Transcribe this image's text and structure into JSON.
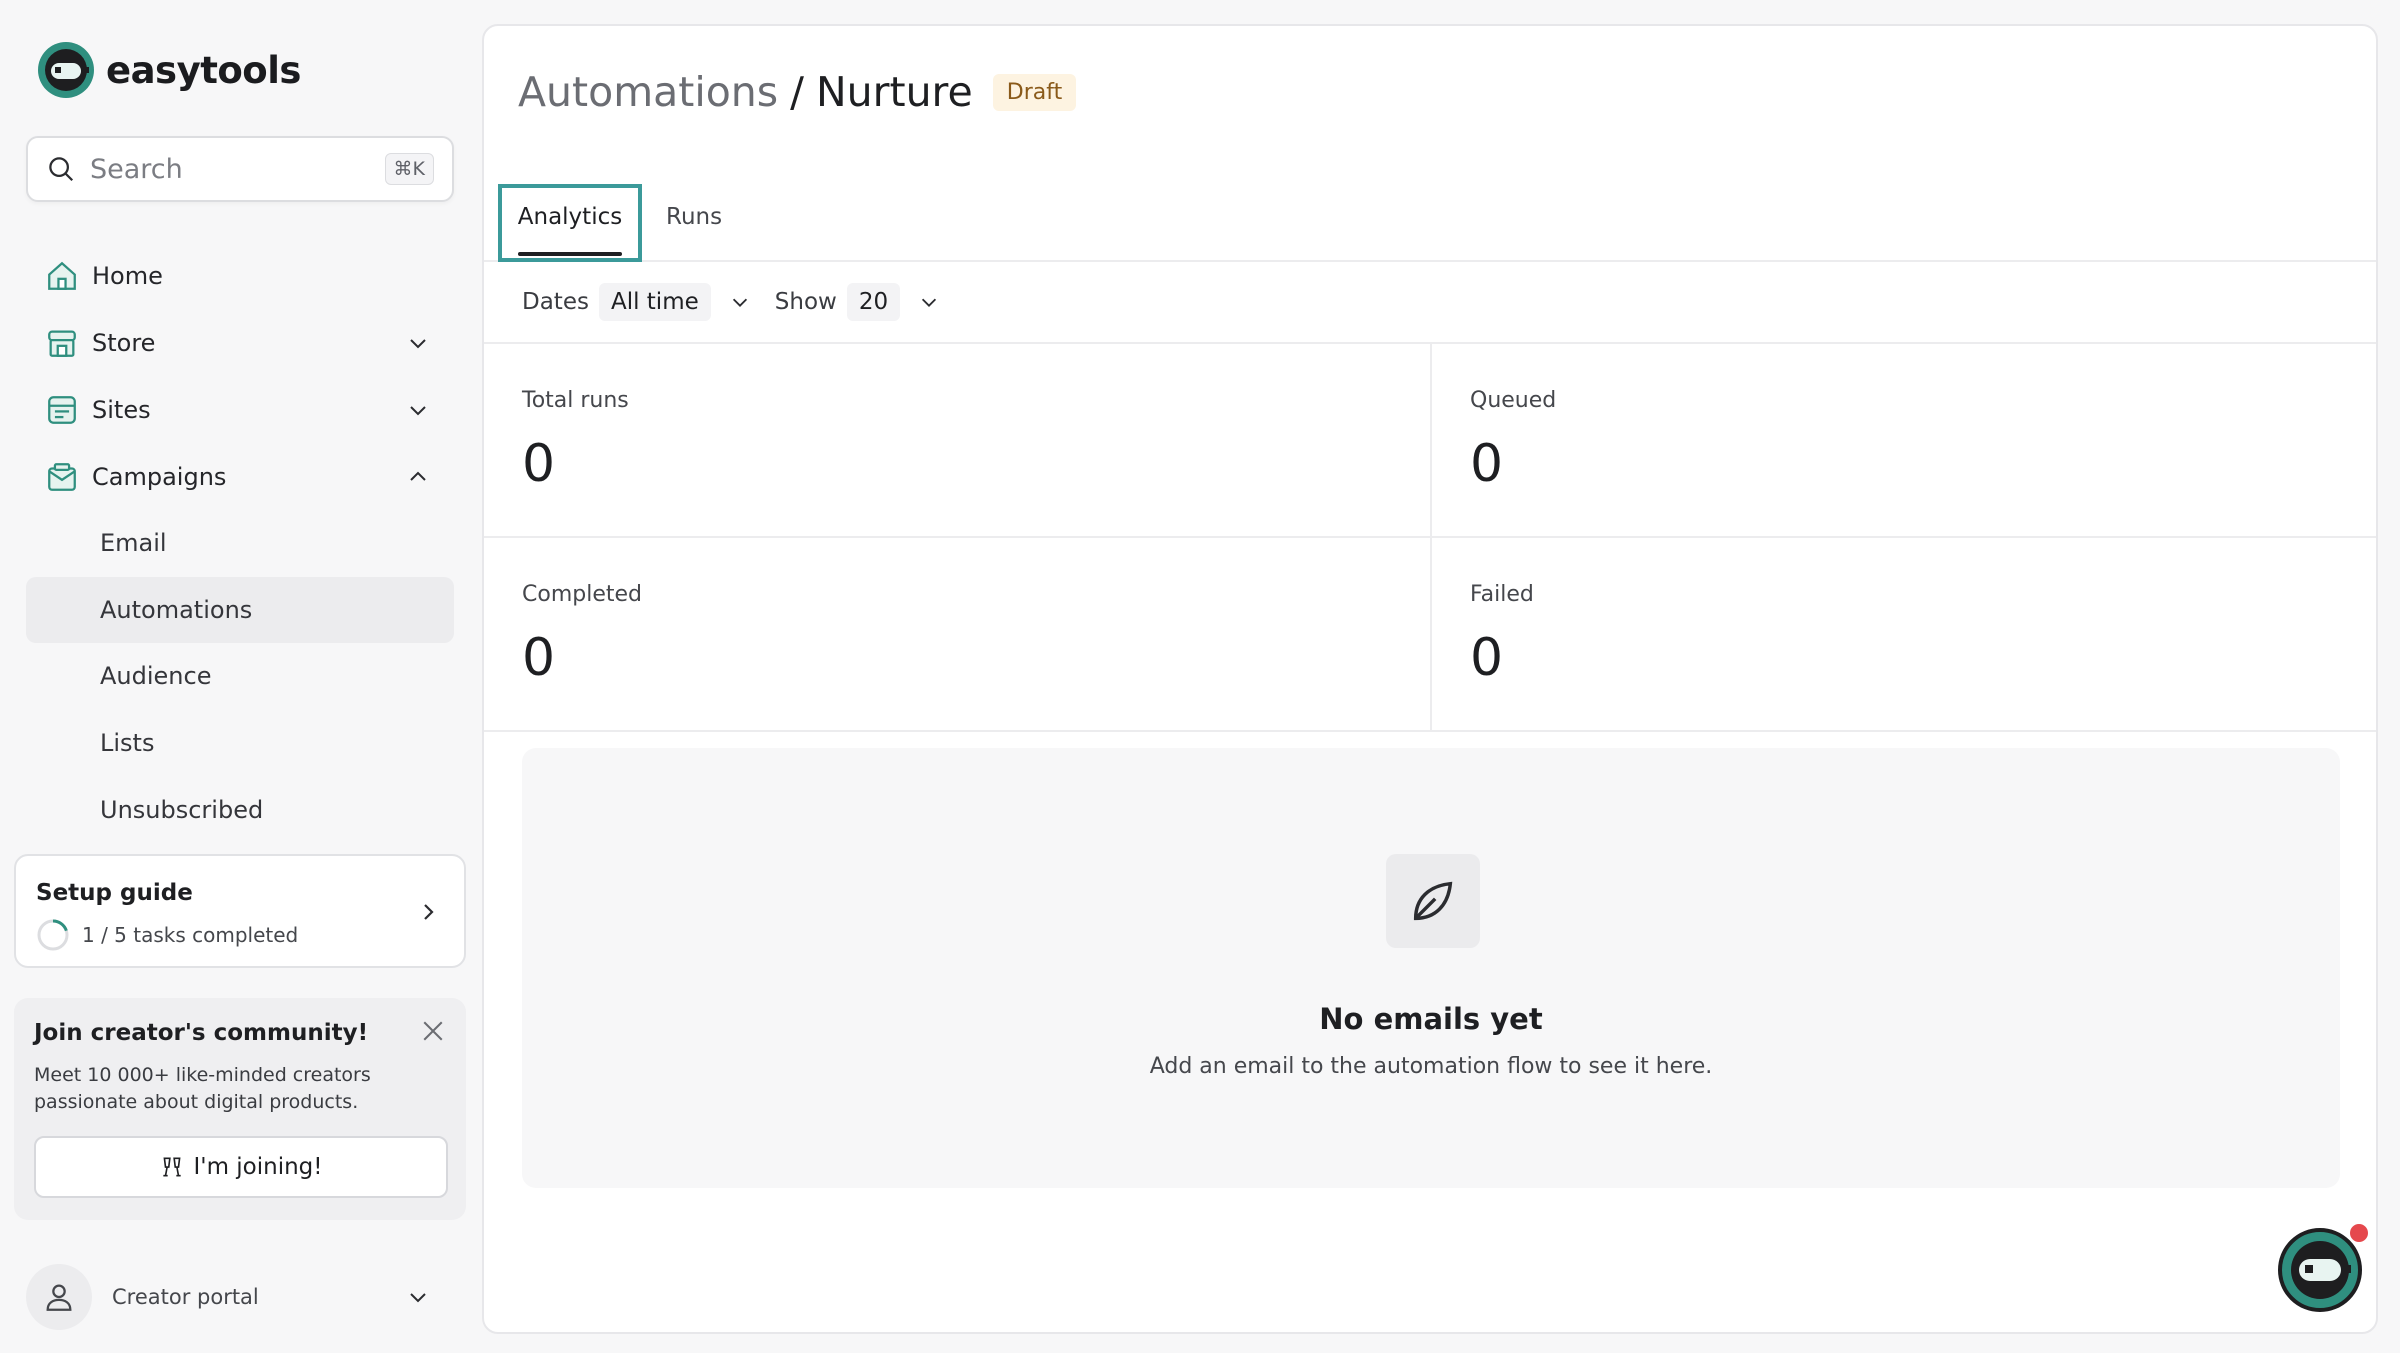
{
  "app": {
    "name": "easytools"
  },
  "search": {
    "placeholder": "Search",
    "shortcut": "⌘K"
  },
  "sidebar": {
    "items": [
      {
        "label": "Home",
        "icon": "home-icon"
      },
      {
        "label": "Store",
        "icon": "store-icon",
        "expanded": false
      },
      {
        "label": "Sites",
        "icon": "sites-icon",
        "expanded": false
      },
      {
        "label": "Campaigns",
        "icon": "campaigns-icon",
        "expanded": true
      }
    ],
    "campaigns_sub": [
      "Email",
      "Automations",
      "Audience",
      "Lists",
      "Unsubscribed"
    ],
    "active_sub": "Automations"
  },
  "setup_guide": {
    "title": "Setup guide",
    "progress": "1 / 5 tasks completed",
    "completed": 1,
    "total": 5
  },
  "community": {
    "title": "Join creator's community!",
    "text": "Meet 10 000+ like-minded creators passionate about digital products.",
    "button": "I'm joining!"
  },
  "user": {
    "label": "Creator portal"
  },
  "header": {
    "parent": "Automations",
    "separator": "/",
    "current": "Nurture",
    "status": "Draft"
  },
  "tabs": [
    {
      "label": "Analytics",
      "active": true
    },
    {
      "label": "Runs",
      "active": false
    }
  ],
  "filters": {
    "dates_label": "Dates",
    "dates_value": "All time",
    "show_label": "Show",
    "show_value": "20"
  },
  "stats": [
    {
      "label": "Total runs",
      "value": "0"
    },
    {
      "label": "Queued",
      "value": "0"
    },
    {
      "label": "Completed",
      "value": "0"
    },
    {
      "label": "Failed",
      "value": "0"
    }
  ],
  "empty_state": {
    "title": "No emails yet",
    "subtitle": "Add an email to the automation flow to see it here.",
    "icon": "leaf-send-icon"
  },
  "colors": {
    "brand": "#2f8f7f",
    "highlight": "#3b9a9a",
    "badge_bg": "#fdf3e1",
    "notification": "#e5484d"
  }
}
